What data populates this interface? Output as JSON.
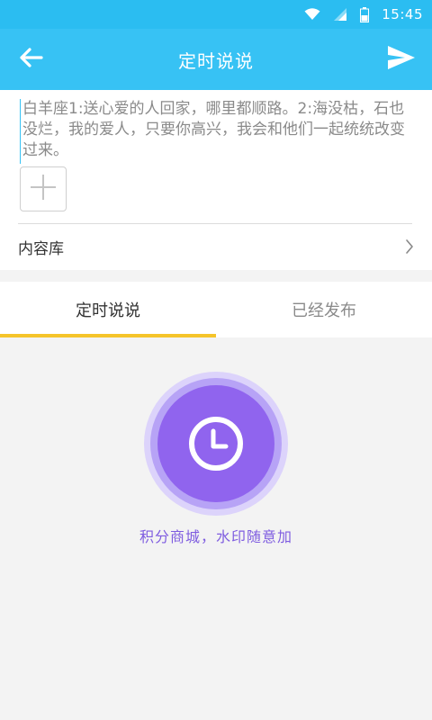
{
  "status_bar": {
    "time": "15:45",
    "icons": [
      "wifi-icon",
      "signal-icon",
      "battery-icon"
    ]
  },
  "app_bar": {
    "title": "定时说说",
    "back_icon": "arrow-left-icon",
    "send_icon": "send-icon"
  },
  "compose": {
    "text": "白羊座1:送心爱的人回家，哪里都顺路。2:海没枯，石也没烂，我的爱人，只要你高兴，我会和他们一起统统改变过来。",
    "add_image_icon": "plus-icon",
    "library_label": "内容库",
    "library_icon": "chevron-right-icon"
  },
  "tabs": [
    {
      "label": "定时说说",
      "active": true
    },
    {
      "label": "已经发布",
      "active": false
    }
  ],
  "empty_state": {
    "icon": "clock-icon",
    "text": "积分商城，水印随意加"
  },
  "colors": {
    "status_bar": "#2bbdf1",
    "app_bar": "#37c2f4",
    "tab_indicator": "#f5c42a",
    "accent_purple": "#7f5de0"
  }
}
